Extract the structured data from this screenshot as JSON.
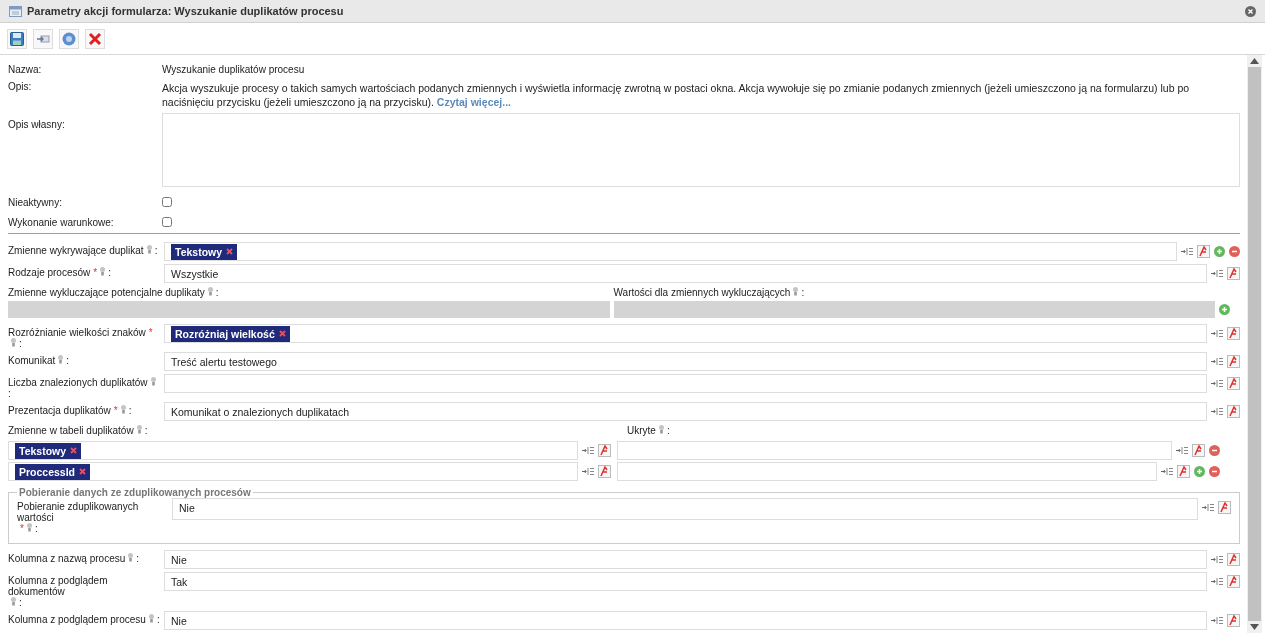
{
  "window": {
    "title": "Parametry akcji formularza: Wyszukanie duplikatów procesu"
  },
  "general": [
    {
      "kind": "text",
      "label": "Nazwa:",
      "value": "Wyszukanie duplikatów procesu"
    },
    {
      "kind": "description",
      "label": "Opis:",
      "value": "Akcja wyszukuje procesy o takich samych wartościach podanych zmiennych i wyświetla informację zwrotną w postaci okna. Akcja wywołuje się po zmianie podanych zmiennych (jeżeli umieszczono ją na formularzu) lub po naciśnięciu przycisku (jeżeli umieszczono ją na przycisku).",
      "link": "Czytaj więcej..."
    },
    {
      "kind": "textarea",
      "label": "Opis własny:"
    },
    {
      "kind": "checkbox",
      "label": "Nieaktywny:",
      "checked": false
    },
    {
      "kind": "checkbox",
      "label": "Wykonanie warunkowe:",
      "checked": false
    }
  ],
  "params": [
    {
      "kind": "tags",
      "label": "Zmienne wykrywające duplikat",
      "colon": ":",
      "tags": [
        "Tekstowy"
      ],
      "add": true,
      "remove": true
    },
    {
      "kind": "text",
      "label": "Rodzaje procesów",
      "required": "*",
      "colon": ":",
      "value": "Wszystkie",
      "add": false,
      "remove": false
    },
    {
      "kind": "split",
      "columns": [
        {
          "label": "Zmienne wykluczające potencjalne duplikaty",
          "colon": ":",
          "disabled": true
        },
        {
          "label": "Wartości dla zmiennych wykluczających",
          "colon": ":",
          "disabled": true
        }
      ],
      "add": true
    },
    {
      "kind": "tags",
      "label": "Rozróżnianie wielkości znaków",
      "required": "*",
      "colon": ":",
      "tags": [
        "Rozróżniaj wielkość"
      ],
      "add": false,
      "remove": false
    },
    {
      "kind": "text",
      "label": "Komunikat",
      "colon": ":",
      "value": "Treść alertu testowego",
      "add": false,
      "remove": false
    },
    {
      "kind": "text",
      "label": "Liczba znalezionych duplikatów",
      "colon": ":",
      "add": false,
      "remove": false
    },
    {
      "kind": "text",
      "label": "Prezentacja duplikatów",
      "required": "*",
      "colon": ":",
      "value": "Komunikat o znalezionych duplikatach",
      "add": false,
      "remove": false
    },
    {
      "kind": "table",
      "columns": [
        {
          "label": "Zmienne w tabeli duplikatów",
          "colon": ":"
        },
        {
          "label": "Ukryte",
          "colon": ":"
        }
      ],
      "rows": [
        {
          "tags": [
            "Tekstowy"
          ],
          "add": false,
          "remove": true
        },
        {
          "tags": [
            "ProccessId"
          ],
          "add": true,
          "remove": true
        }
      ]
    },
    {
      "kind": "group",
      "legend": "Pobieranie danych ze zduplikowanych procesów",
      "children": [
        {
          "kind": "text",
          "label": "Pobieranie zduplikowanych wartości",
          "required": "*",
          "colon": ":",
          "value": "Nie",
          "add": false,
          "remove": false
        }
      ]
    },
    {
      "kind": "text",
      "label": "Kolumna z nazwą procesu",
      "colon": ":",
      "value": "Nie",
      "add": false,
      "remove": false
    },
    {
      "kind": "text",
      "label": "Kolumna z podglądem dokumentów",
      "colon": ":",
      "value": "Tak",
      "add": false,
      "remove": false
    },
    {
      "kind": "text",
      "label": "Kolumna z podglądem procesu",
      "colon": ":",
      "value": "Nie",
      "add": false,
      "remove": false
    }
  ]
}
